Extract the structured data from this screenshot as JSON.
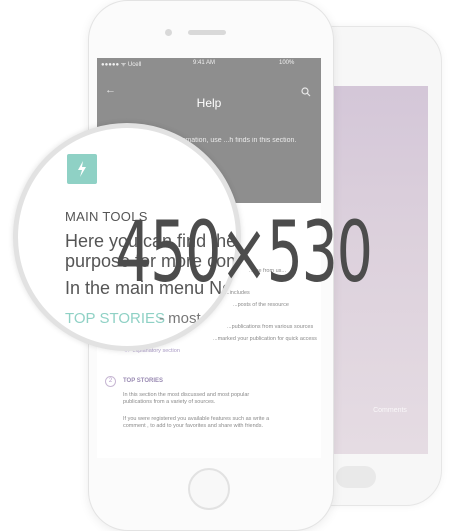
{
  "status_bar": {
    "carrier": "●●●●● ᯤ Ucell",
    "time": "9:41 AM",
    "battery": "100%"
  },
  "nav": {
    "title": "Help",
    "back_icon": "arrow-left-icon",
    "search_icon": "search-icon",
    "intro_text": "...ted in specific information, use ...h finds in this section."
  },
  "content": {
    "lines": [
      "...ore from us...",
      "...includes",
      "...posts of the resource",
      "...publications from various sources",
      "...marked your publication for quick access"
    ],
    "explanatory": "explanatory section",
    "step_two_number": "2",
    "top_stories_heading": "TOP STORIES",
    "top_stories_text_1": "In this section the most discussed and most popular",
    "top_stories_text_2": "publications from a variety of sources.",
    "top_stories_text_3": "If you were registered you available features such as write a",
    "top_stories_text_4": "comment , to add to your favorites and share with friends."
  },
  "magnifier": {
    "heading": "MAIN TOOLS",
    "text_line_1": "Here you can find the ma",
    "text_line_2": "purpose for more comfor",
    "text_line_3": "In the main menu Ne",
    "top_stories": "TOP STORIES",
    "most": "- most",
    "icon": "lightning-icon"
  },
  "back_phone": {
    "comments_label": "Comments"
  },
  "overlay": {
    "dimensions": "450×530"
  },
  "colors": {
    "nav_bg": "#8e8e8e",
    "accent_mint": "#8fd1c5",
    "accent_purple": "#b39bc8",
    "overlay_text": "#4c4c4c"
  }
}
